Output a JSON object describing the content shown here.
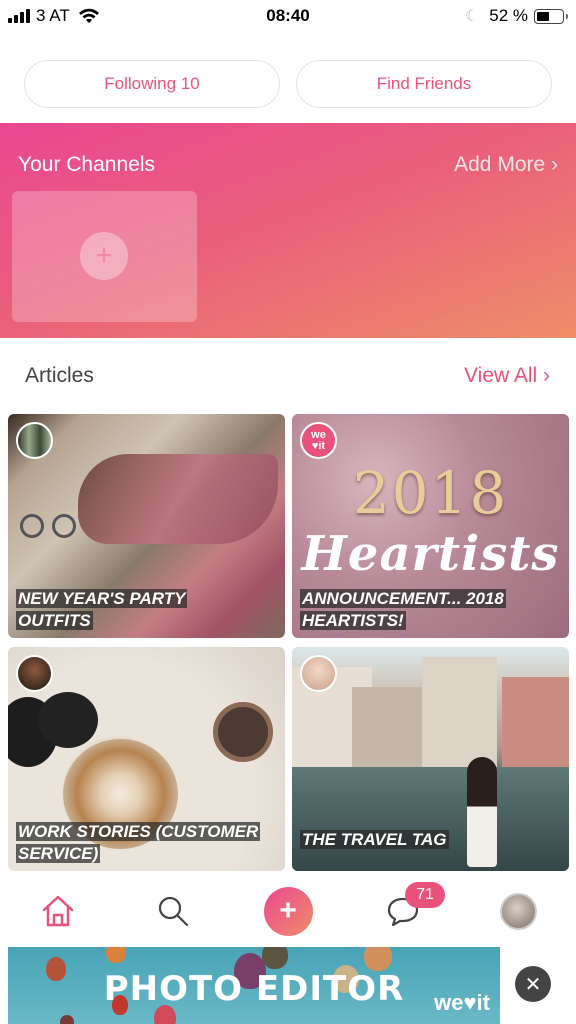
{
  "status_bar": {
    "carrier": "3 AT",
    "time": "08:40",
    "battery_percent_label": "52 %",
    "battery_level": 0.52
  },
  "top_buttons": {
    "following_label": "Following 10",
    "find_friends_label": "Find Friends"
  },
  "channels": {
    "title": "Your Channels",
    "add_more_label": "Add More ›",
    "add_icon": "+"
  },
  "articles": {
    "title": "Articles",
    "view_all_label": "View All ›",
    "items": [
      {
        "caption_line1": "NEW YEAR'S PARTY",
        "caption_line2": "OUTFITS",
        "author_avatar": "user-avatar"
      },
      {
        "caption_line1": "ANNOUNCEMENT... 2018",
        "caption_line2": "HEARTISTS!",
        "author_avatar": "weheartit-logo",
        "image_text_year": "2018",
        "image_text_word": "Heartists",
        "logo_line1": "we",
        "logo_line2": "♥it"
      },
      {
        "caption_line1": "WORK STORIES (CUSTOMER",
        "caption_line2": "SERVICE)",
        "author_avatar": "user-avatar"
      },
      {
        "caption_line1": "THE TRAVEL TAG",
        "caption_line2": "",
        "author_avatar": "user-avatar"
      }
    ]
  },
  "tab_bar": {
    "home_icon": "home-icon",
    "search_icon": "search-icon",
    "add_label": "+",
    "messages_badge": "71",
    "profile_icon": "profile-avatar"
  },
  "ad": {
    "title": "PHOTO EDITOR",
    "brand": "we♥it",
    "close_label": "✕"
  },
  "colors": {
    "accent": "#e9537b",
    "gradient_start": "#e94891",
    "gradient_end": "#ef8c68"
  }
}
